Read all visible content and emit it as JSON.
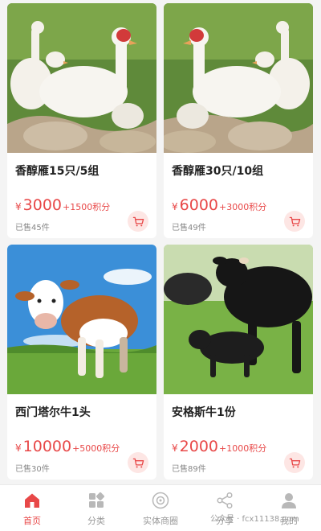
{
  "products": [
    {
      "name": "香醇雁15只/5组",
      "currency": "¥",
      "price": "3000",
      "points": "+1500积分",
      "sold": "已售45件"
    },
    {
      "name": "香醇雁30只/10组",
      "currency": "¥",
      "price": "6000",
      "points": "+3000积分",
      "sold": "已售49件"
    },
    {
      "name": "西门塔尔牛1头",
      "currency": "¥",
      "price": "10000",
      "points": "+5000积分",
      "sold": "已售30件"
    },
    {
      "name": "安格斯牛1份",
      "currency": "¥",
      "price": "2000",
      "points": "+1000积分",
      "sold": "已售89件"
    }
  ],
  "tabbar": {
    "items": [
      {
        "label": "首页",
        "icon": "home-icon",
        "active": true
      },
      {
        "label": "分类",
        "icon": "category-icon",
        "active": false
      },
      {
        "label": "实体商圈",
        "icon": "store-circle-icon",
        "active": false
      },
      {
        "label": "分享",
        "icon": "share-icon",
        "active": false
      },
      {
        "label": "我的",
        "icon": "user-icon",
        "active": false
      }
    ]
  },
  "watermark": "公众号 · fcx11138.com",
  "colors": {
    "accent": "#e84848",
    "cart_bg": "#fde6e4",
    "page_bg": "#f4f4f4"
  }
}
